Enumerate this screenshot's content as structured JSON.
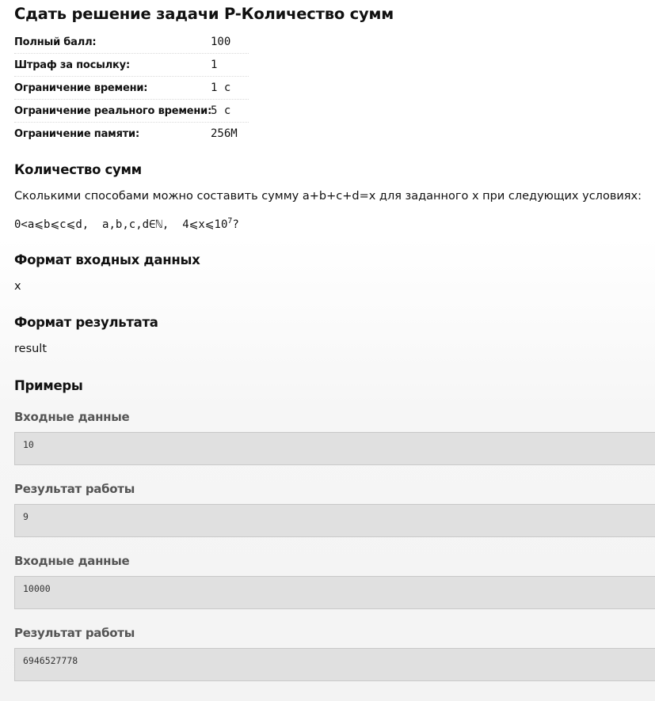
{
  "page_title": "Сдать решение задачи P-Количество сумм",
  "limits": [
    {
      "label": "Полный балл:",
      "value": "100"
    },
    {
      "label": "Штраф за посылку:",
      "value": "1"
    },
    {
      "label": "Ограничение времени:",
      "value": "1 с"
    },
    {
      "label": "Ограничение реального времени:",
      "value": "5 с"
    },
    {
      "label": "Ограничение памяти:",
      "value": "256M"
    }
  ],
  "statement": {
    "heading": "Количество сумм",
    "text": "Сколькими способами можно составить сумму a+b+c+d=x для заданного x при следующих условиях:",
    "formula_base": "0<a⩽b⩽c⩽d,  a,b,c,d∈ℕ,  4⩽x⩽10",
    "formula_exp": "7",
    "formula_tail": "?"
  },
  "input_format": {
    "heading": "Формат входных данных",
    "text": "x"
  },
  "output_format": {
    "heading": "Формат результата",
    "text": "result"
  },
  "examples": {
    "heading": "Примеры",
    "items": [
      {
        "label": "Входные данные",
        "value": "10"
      },
      {
        "label": "Результат работы",
        "value": "9"
      },
      {
        "label": "Входные данные",
        "value": "10000"
      },
      {
        "label": "Результат работы",
        "value": "6946527778"
      }
    ]
  }
}
